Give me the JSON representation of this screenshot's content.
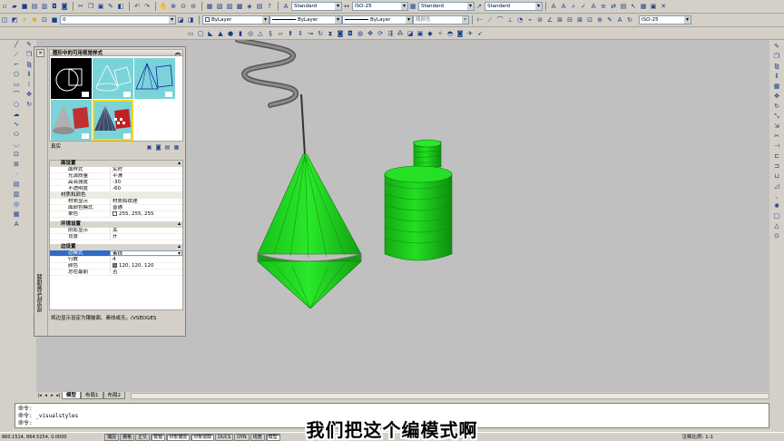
{
  "toolbar_top": {
    "text_style": "Standard",
    "dim_style": "ISO-25",
    "table_style": "Standard",
    "multileader_style": "Standard"
  },
  "toolbar_layers": {
    "layer_name": "0",
    "color": "ByLayer",
    "linetype": "ByLayer",
    "lineweight": "ByLayer",
    "plot_style": "随颜色",
    "right_dim_style": "ISO-25"
  },
  "palette": {
    "title": "视觉样式管理器",
    "styles_header": "图形中的可用视觉样式",
    "current_style": "真实",
    "face_group": "面设置",
    "face_rows": [
      {
        "key": "面样式",
        "value": "实时"
      },
      {
        "key": "光源质量",
        "value": "平滑"
      },
      {
        "key": "高亮强度",
        "value": "-30"
      },
      {
        "key": "不透明度",
        "value": "-60"
      }
    ],
    "material_group": "材质和颜色",
    "material_rows": [
      {
        "key": "材质显示",
        "value": "材质和纹理"
      },
      {
        "key": "面颜色模式",
        "value": "普通"
      },
      {
        "key": "单色",
        "value": "255, 255, 255"
      }
    ],
    "env_group": "环境设置",
    "env_rows": [
      {
        "key": "阴影显示",
        "value": "关"
      },
      {
        "key": "背景",
        "value": "开"
      }
    ],
    "edge_group": "边设置",
    "edge_rows": [
      {
        "key": "边模式",
        "value": "素线"
      },
      {
        "key": "行数",
        "value": "4"
      },
      {
        "key": "颜色",
        "value": "120, 120, 120"
      },
      {
        "key": "总在最前",
        "value": "否"
      }
    ],
    "description": "将边显示设定为镶嵌面、素线或无。(VSEDGES"
  },
  "tabs": [
    "模型",
    "布局1",
    "布局2"
  ],
  "command_lines": [
    "命令:",
    "命令: _visualstyles",
    "命令:"
  ],
  "status": {
    "coords": "860.1514, 864.5254, 0.0000",
    "toggles": [
      "捕捉",
      "栅格",
      "正交",
      "极轴",
      "对象捕捉",
      "对象追踪",
      "DUCS",
      "DYN",
      "线宽",
      "模型"
    ],
    "annotation_scale": "注释比例: 1:1"
  },
  "subtitle": "我们把这个编模式啊",
  "scene_colors": {
    "viewport_bg": "#c0c0c0",
    "solid_green": "#1ed81e",
    "edge_grey": "#787878"
  }
}
